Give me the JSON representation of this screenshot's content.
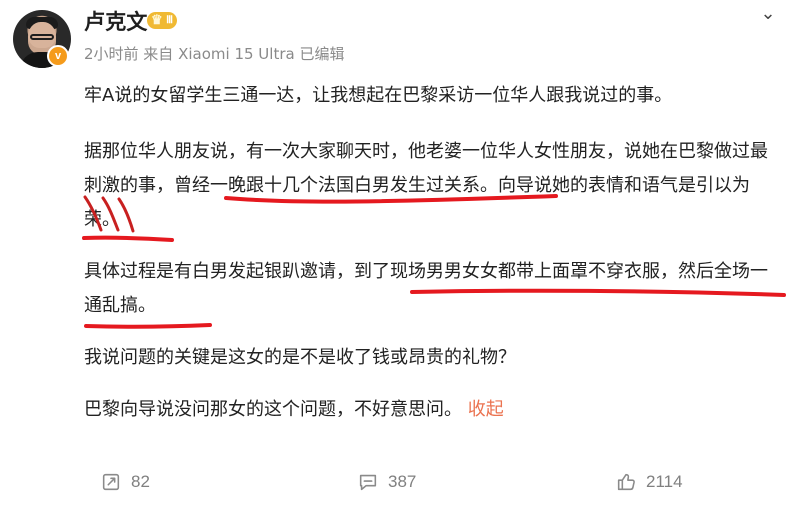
{
  "post": {
    "author": "卢克文",
    "level_badge": "Ⅲ",
    "meta": "2小时前 来自 Xiaomi 15 Ultra 已编辑",
    "paragraphs": [
      "牢A说的女留学生三通一达，让我想起在巴黎采访一位华人跟我说过的事。",
      "据那位华人朋友说，有一次大家聊天时，他老婆一位华人女性朋友，说她在巴黎做过最刺激的事，曾经一晚跟十几个法国白男发生过关系。向导说她的表情和语气是引以为荣。",
      "具体过程是有白男发起银趴邀请，到了现场男男女女都带上面罩不穿衣服，然后全场一通乱搞。",
      "我说问题的关键是这女的是不是收了钱或昂贵的礼物？",
      "巴黎向导说没问那女的这个问题，不好意思问。"
    ],
    "collapse_label": "收起"
  },
  "actions": {
    "repost_count": "82",
    "comment_count": "387",
    "like_count": "2114"
  },
  "icons": {
    "menu": "chevron-down-icon",
    "verified": "verified-badge-icon",
    "level": "level-badge-icon",
    "repost": "repost-icon",
    "comment": "comment-icon",
    "like": "like-icon"
  },
  "colors": {
    "accent": "#eb7350",
    "meta": "#8a8a8a",
    "text": "#222222",
    "underline": "#e5191f",
    "badge_orange": "#f59b1b",
    "level_gold": "#f0b933"
  }
}
